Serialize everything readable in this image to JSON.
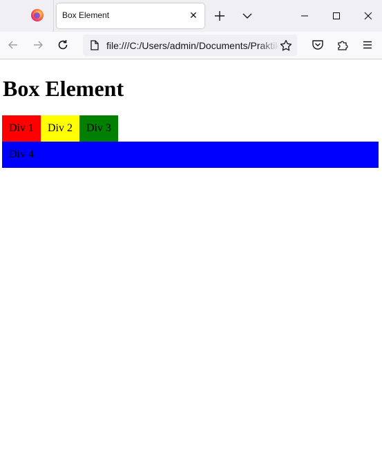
{
  "tab": {
    "title": "Box Element",
    "close_glyph": "✕"
  },
  "navbar": {
    "url": "file:///C:/Users/admin/Documents/Praktikum"
  },
  "page": {
    "heading": "Box Element",
    "boxes": [
      {
        "label": "Div 1",
        "color": "#ff0000"
      },
      {
        "label": "Div 2",
        "color": "#ffff00"
      },
      {
        "label": "Div 3",
        "color": "#008000"
      },
      {
        "label": "Div 4",
        "color": "#0000ff"
      }
    ]
  },
  "icons": {
    "browser": "firefox-logo-icon",
    "new_tab": "plus-icon",
    "list_tabs": "chevron-down-icon",
    "minimize": "minimize-icon",
    "maximize": "maximize-icon",
    "close": "close-icon",
    "back": "arrow-left-icon",
    "forward": "arrow-right-icon",
    "reload": "reload-icon",
    "page": "page-icon",
    "bookmark": "star-icon",
    "pocket": "pocket-icon",
    "extensions": "puzzle-icon",
    "menu": "hamburger-icon"
  }
}
